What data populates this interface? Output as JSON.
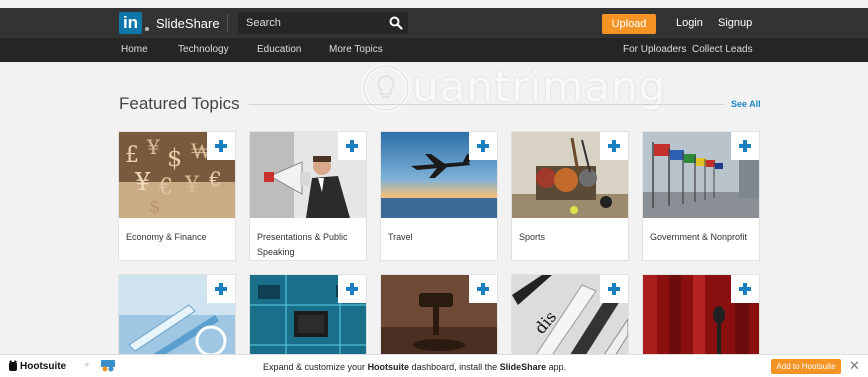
{
  "header": {
    "logo_text": "in",
    "brand": "SlideShare",
    "search_placeholder": "Search",
    "upload_label": "Upload",
    "login_label": "Login",
    "signup_label": "Signup"
  },
  "nav": {
    "left": [
      "Home",
      "Technology",
      "Education",
      "More Topics"
    ],
    "right": [
      "For Uploaders",
      "Collect Leads"
    ]
  },
  "watermark": {
    "text": "uantrimang"
  },
  "featured": {
    "title": "Featured Topics",
    "see_all": "See All",
    "cards": [
      {
        "label": "Economy & Finance"
      },
      {
        "label": "Presentations & Public Speaking"
      },
      {
        "label": "Travel"
      },
      {
        "label": "Sports"
      },
      {
        "label": "Government & Nonprofit"
      },
      {
        "label": ""
      },
      {
        "label": ""
      },
      {
        "label": ""
      },
      {
        "label": ""
      },
      {
        "label": ""
      }
    ]
  },
  "hootsuite_bar": {
    "logo": "Hootsuite",
    "message_prefix": "Expand & customize your ",
    "message_bold1": "Hootsuite",
    "message_middle": " dashboard, install the ",
    "message_bold2": "SlideShare",
    "message_suffix": " app.",
    "button_label": "Add to Hootsuite",
    "close_label": "✕"
  },
  "colors": {
    "accent_orange": "#f59425",
    "linkedin_blue": "#0e76a8",
    "plus_blue": "#1a7fc1",
    "topbar": "#333333"
  }
}
